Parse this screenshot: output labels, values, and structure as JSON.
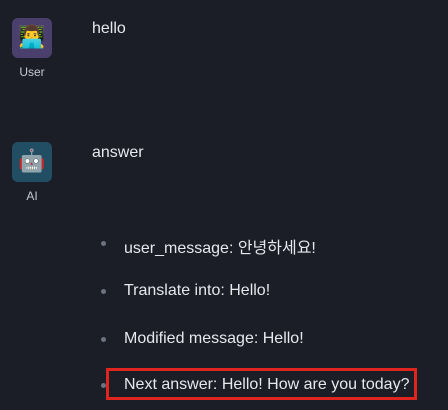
{
  "messages": {
    "user": {
      "avatar_icon": "user-emoji-icon",
      "avatar_glyph": "👨‍💻",
      "name": "User",
      "text": "hello"
    },
    "ai": {
      "avatar_icon": "robot-icon",
      "avatar_glyph": "🤖",
      "name": "AI",
      "text": "answer",
      "items": [
        "user_message: 안녕하세요!",
        "Translate into: Hello!",
        "Modified message: Hello!",
        "Next answer: Hello! How are you today?"
      ]
    }
  },
  "colors": {
    "background": "#1b1e27",
    "highlight": "#e0251e"
  }
}
